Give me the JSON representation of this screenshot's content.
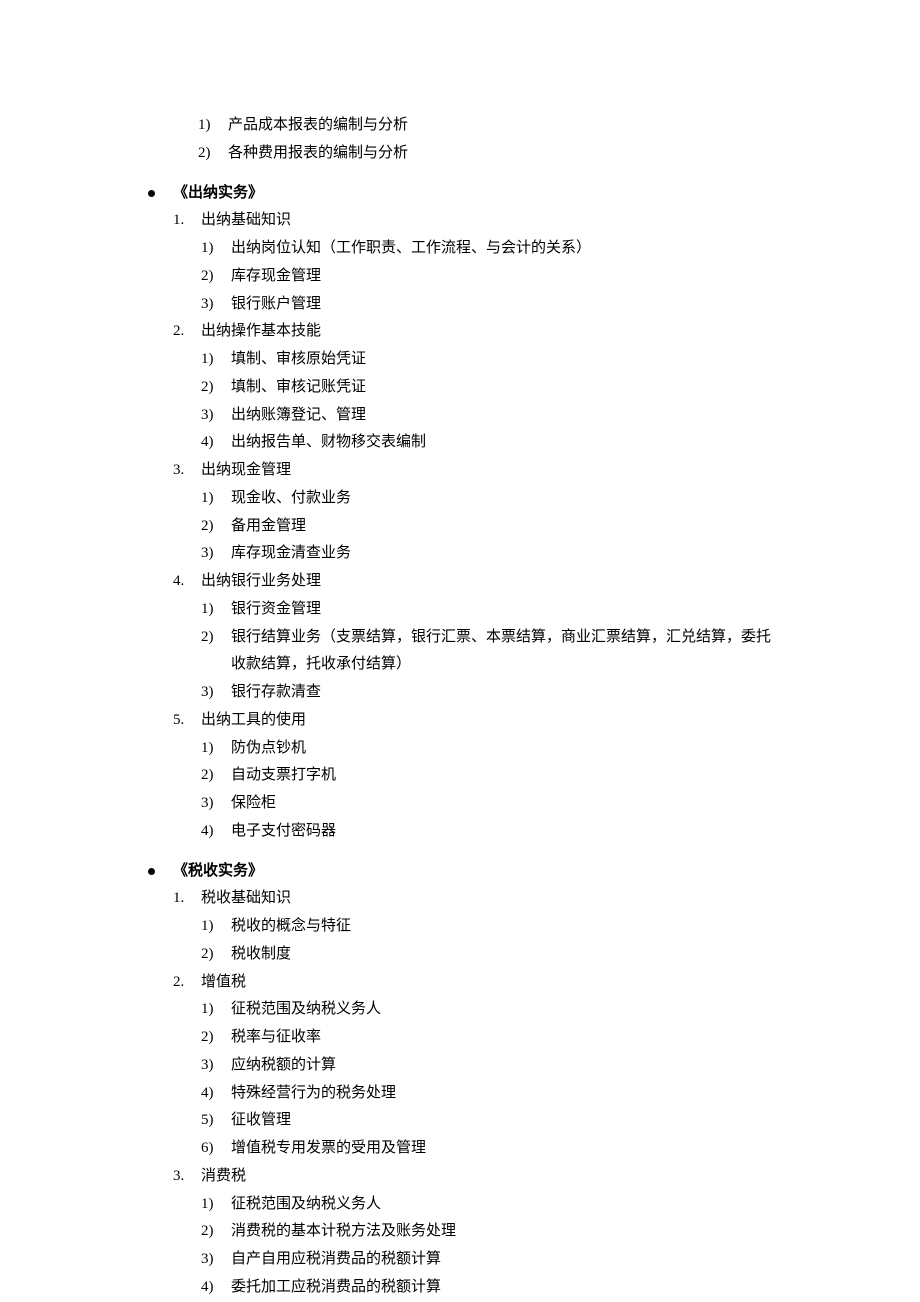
{
  "preItems": [
    {
      "n": "1)",
      "t": "产品成本报表的编制与分析"
    },
    {
      "n": "2)",
      "t": "各种费用报表的编制与分析"
    }
  ],
  "sections": [
    {
      "title": "《出纳实务》",
      "items": [
        {
          "n": "1.",
          "t": "出纳基础知识",
          "subs": [
            {
              "n": "1)",
              "t": "出纳岗位认知（工作职责、工作流程、与会计的关系）"
            },
            {
              "n": "2)",
              "t": "库存现金管理"
            },
            {
              "n": "3)",
              "t": "银行账户管理"
            }
          ]
        },
        {
          "n": "2.",
          "t": "出纳操作基本技能",
          "subs": [
            {
              "n": "1)",
              "t": "填制、审核原始凭证"
            },
            {
              "n": "2)",
              "t": "填制、审核记账凭证"
            },
            {
              "n": "3)",
              "t": "出纳账簿登记、管理"
            },
            {
              "n": "4)",
              "t": "出纳报告单、财物移交表编制"
            }
          ]
        },
        {
          "n": "3.",
          "t": "出纳现金管理",
          "subs": [
            {
              "n": "1)",
              "t": "现金收、付款业务"
            },
            {
              "n": "2)",
              "t": "备用金管理"
            },
            {
              "n": "3)",
              "t": "库存现金清查业务"
            }
          ]
        },
        {
          "n": "4.",
          "t": "出纳银行业务处理",
          "subs": [
            {
              "n": "1)",
              "t": "银行资金管理"
            },
            {
              "n": "2)",
              "t": "银行结算业务（支票结算，银行汇票、本票结算，商业汇票结算，汇兑结算，委托收款结算，托收承付结算）",
              "wrap": true
            },
            {
              "n": "3)",
              "t": "银行存款清查"
            }
          ]
        },
        {
          "n": "5.",
          "t": "出纳工具的使用",
          "subs": [
            {
              "n": "1)",
              "t": "防伪点钞机"
            },
            {
              "n": "2)",
              "t": "自动支票打字机"
            },
            {
              "n": "3)",
              "t": "保险柜"
            },
            {
              "n": "4)",
              "t": "电子支付密码器"
            }
          ]
        }
      ]
    },
    {
      "title": "《税收实务》",
      "items": [
        {
          "n": "1.",
          "t": "税收基础知识",
          "subs": [
            {
              "n": "1)",
              "t": "税收的概念与特征"
            },
            {
              "n": "2)",
              "t": "税收制度"
            }
          ]
        },
        {
          "n": "2.",
          "t": "增值税",
          "subs": [
            {
              "n": "1)",
              "t": "征税范围及纳税义务人"
            },
            {
              "n": "2)",
              "t": "税率与征收率"
            },
            {
              "n": "3)",
              "t": "应纳税额的计算"
            },
            {
              "n": "4)",
              "t": "特殊经营行为的税务处理"
            },
            {
              "n": "5)",
              "t": "征收管理"
            },
            {
              "n": "6)",
              "t": "增值税专用发票的受用及管理"
            }
          ]
        },
        {
          "n": "3.",
          "t": "消费税",
          "subs": [
            {
              "n": "1)",
              "t": "征税范围及纳税义务人"
            },
            {
              "n": "2)",
              "t": "消费税的基本计税方法及账务处理"
            },
            {
              "n": "3)",
              "t": "自产自用应税消费品的税额计算"
            },
            {
              "n": "4)",
              "t": "委托加工应税消费品的税额计算"
            }
          ]
        }
      ]
    }
  ]
}
